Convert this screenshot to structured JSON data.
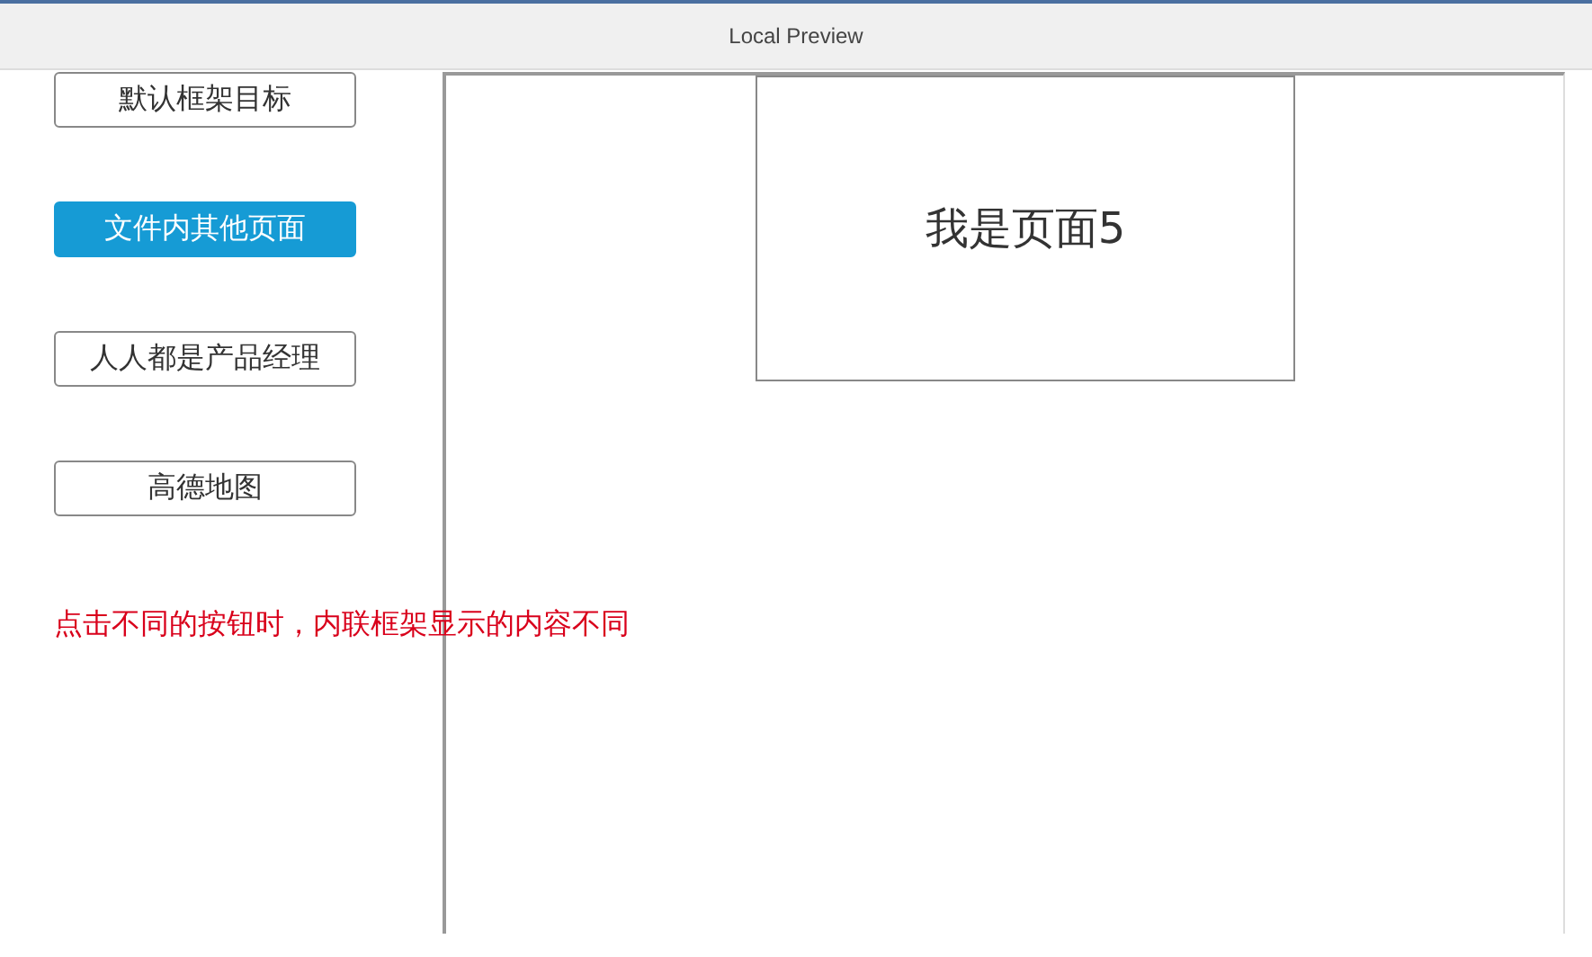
{
  "window": {
    "title": "Local Preview"
  },
  "buttons": [
    {
      "label": "默认框架目标",
      "selected": false
    },
    {
      "label": "文件内其他页面",
      "selected": true
    },
    {
      "label": "人人都是产品经理",
      "selected": false
    },
    {
      "label": "高德地图",
      "selected": false
    }
  ],
  "note": "点击不同的按钮时，内联框架显示的内容不同",
  "inline_frame": {
    "page_text": "我是页面5"
  }
}
